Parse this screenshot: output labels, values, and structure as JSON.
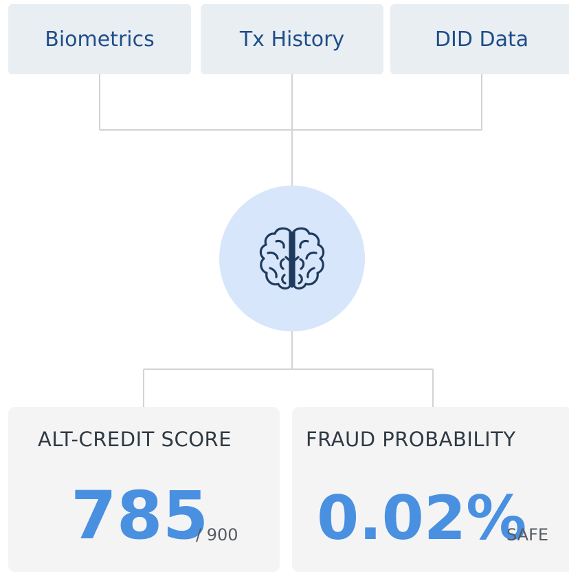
{
  "inputs": [
    {
      "label": "Biometrics"
    },
    {
      "label": "Tx History"
    },
    {
      "label": "DID Data"
    }
  ],
  "engine": {
    "icon": "brain-icon"
  },
  "outputs": {
    "credit": {
      "title": "ALT-CREDIT SCORE",
      "value": "785",
      "suffix": "/ 900"
    },
    "fraud": {
      "title": "FRAUD PROBABILITY",
      "value": "0.02%",
      "suffix": "SAFE"
    }
  },
  "colors": {
    "input_box": "#e9eef3",
    "input_text": "#1f4e87",
    "circle": "#d8e6fb",
    "icon_stroke": "#1e3a5c",
    "output_box": "#f4f4f5",
    "value": "#4a90e0",
    "connector": "#d3d3d3"
  }
}
